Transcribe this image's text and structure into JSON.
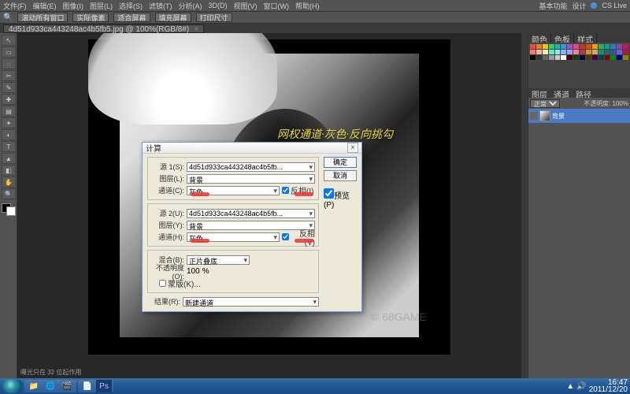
{
  "menu": {
    "items": [
      "文件(F)",
      "编辑(E)",
      "图像(I)",
      "图层(L)",
      "选择(S)",
      "滤镜(T)",
      "分析(A)",
      "3D(D)",
      "视图(V)",
      "窗口(W)",
      "帮助(H)"
    ],
    "right": [
      "基本功能",
      "设计"
    ],
    "cslive": "CS Live"
  },
  "optbar": {
    "windowbtn": "滚动所有窗口",
    "btns": [
      "实际像素",
      "适合屏幕",
      "填充屏幕",
      "打印尺寸"
    ]
  },
  "tab": {
    "label": "4d51d933ca443248ac4b5fb5.jpg @ 100%(RGB/8#)"
  },
  "overlay": "网权通道·灰色·反向挑勾",
  "watermark": "© 68GAME",
  "statusline": "曝光只在 32 位起作用",
  "dialog": {
    "title": "计算",
    "ok": "确定",
    "cancel": "取消",
    "preview": "预览(P)",
    "source1": {
      "legend": "源 1(S):",
      "file": "4d51d933ca443248ac4b5fb...",
      "layer_lbl": "图层(L):",
      "layer": "背景",
      "chan_lbl": "通道(C):",
      "chan": "灰色",
      "invert": "反相(I)"
    },
    "source2": {
      "legend": "源 2(U):",
      "file": "4d51d933ca443248ac4b5fb...",
      "layer_lbl": "图层(Y):",
      "layer": "背景",
      "chan_lbl": "通道(H):",
      "chan": "灰色",
      "invert": "反相(V)"
    },
    "blend_lbl": "混合(B):",
    "blend": "正片叠底",
    "opacity_lbl": "不透明度(O):",
    "opacity": "100",
    "pct": "%",
    "mask": "蒙版(K)...",
    "result_lbl": "结果(R):",
    "result": "新建通道"
  },
  "layers": {
    "tabA": [
      "颜色",
      "色板",
      "样式"
    ],
    "tabB": [
      "图层",
      "通道",
      "路径"
    ],
    "mode": "正常",
    "opacity": "不透明度: 100%",
    "item": "背景"
  },
  "tools": [
    "↖",
    "▭",
    "◌",
    "✂",
    "✎",
    "✚",
    "▤",
    "✦",
    "◐",
    "T",
    "▲",
    "◧",
    "✋",
    "🔍"
  ],
  "taskbar": {
    "icons": [
      "📁",
      "🌐",
      "🎬",
      "📄",
      "Ps"
    ],
    "time": "16:47",
    "date": "2011/12/20"
  },
  "swatch_colors": [
    "#e74c3c",
    "#e67e22",
    "#f1c40f",
    "#2ecc71",
    "#1abc9c",
    "#3498db",
    "#9b59b6",
    "#e84393",
    "#c0392b",
    "#d35400",
    "#f39c12",
    "#27ae60",
    "#16a085",
    "#2980b9",
    "#8e44ad",
    "#c2185b",
    "#ff7675",
    "#fab1a0",
    "#ffeaa7",
    "#55efc4",
    "#81ecec",
    "#74b9ff",
    "#a29bfe",
    "#fd79a8",
    "#b33939",
    "#cc8e35",
    "#ccae62",
    "#218c74",
    "#1e6f72",
    "#2c5aa0",
    "#6c5ce7",
    "#b71540",
    "#000",
    "#333",
    "#666",
    "#999",
    "#ccc",
    "#fff",
    "#400",
    "#040",
    "#004",
    "#440",
    "#404",
    "#044",
    "#800",
    "#080",
    "#008",
    "#880"
  ]
}
